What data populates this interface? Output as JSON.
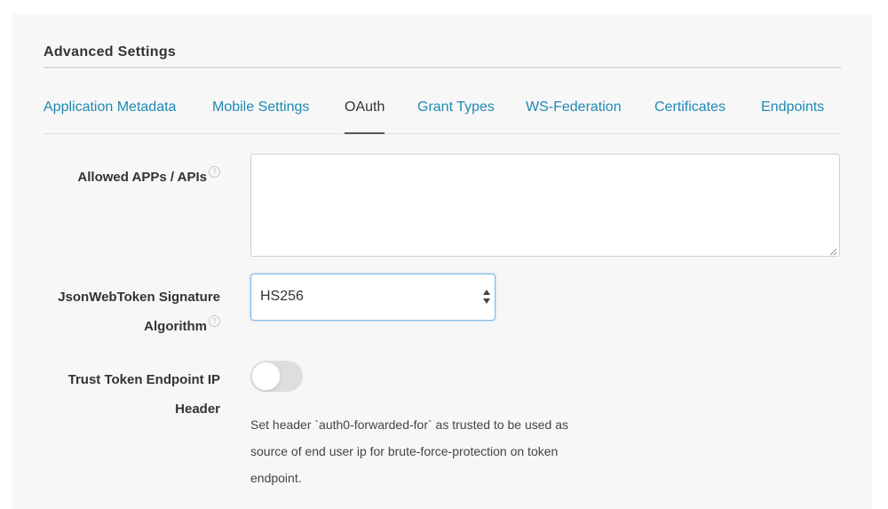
{
  "section": {
    "title": "Advanced Settings"
  },
  "tabs": [
    {
      "label": "Application Metadata",
      "active": false
    },
    {
      "label": "Mobile Settings",
      "active": false
    },
    {
      "label": "OAuth",
      "active": true
    },
    {
      "label": "Grant Types",
      "active": false
    },
    {
      "label": "WS-Federation",
      "active": false
    },
    {
      "label": "Certificates",
      "active": false
    },
    {
      "label": "Endpoints",
      "active": false
    }
  ],
  "fields": {
    "allowed_apps": {
      "label": "Allowed APPs / APIs",
      "help_icon": "question-mark-icon",
      "value": ""
    },
    "jwt_algorithm": {
      "label_line1": "JsonWebToken Signature",
      "label_line2": "Algorithm",
      "help_icon": "question-mark-icon",
      "selected": "HS256"
    },
    "trust_token": {
      "label_line1": "Trust Token Endpoint IP",
      "label_line2": "Header",
      "toggle_on": false,
      "description": "Set header `auth0-forwarded-for` as trusted to be used as source of end user ip for brute-force-protection on token endpoint."
    }
  },
  "colors": {
    "link": "#1f8ab3",
    "text": "#333333",
    "panel_bg": "#f7f7f7",
    "focus_border": "#7ab8e8"
  }
}
